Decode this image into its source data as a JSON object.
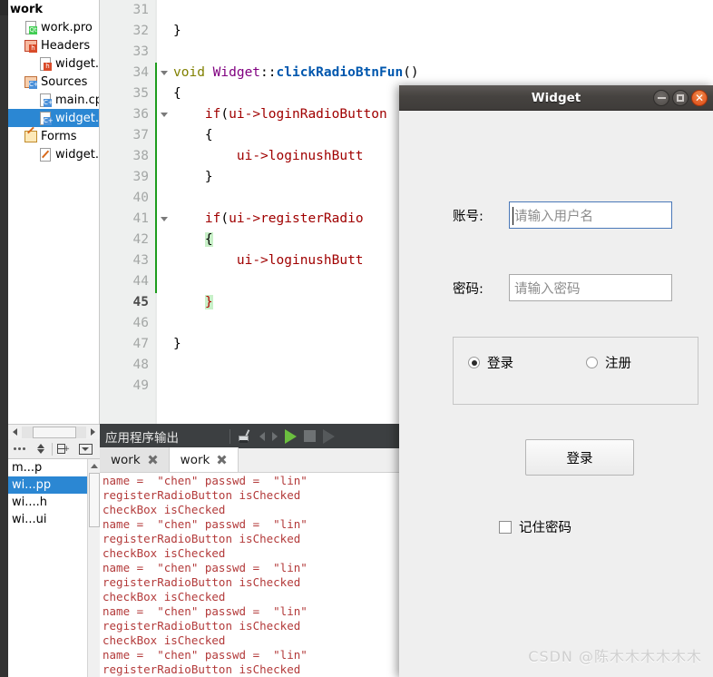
{
  "ide": {
    "project_tree": {
      "items": [
        {
          "label": "work",
          "indent": 0,
          "icon": "project-icon",
          "bold": true,
          "selected": false
        },
        {
          "label": "work.pro",
          "indent": 1,
          "icon": "qt-project-icon",
          "bold": false,
          "selected": false
        },
        {
          "label": "Headers",
          "indent": 1,
          "icon": "headers-folder-icon",
          "bold": false,
          "selected": false
        },
        {
          "label": "widget.h",
          "indent": 2,
          "icon": "header-file-icon",
          "bold": false,
          "selected": false
        },
        {
          "label": "Sources",
          "indent": 1,
          "icon": "sources-folder-icon",
          "bold": false,
          "selected": false
        },
        {
          "label": "main.cpp",
          "indent": 2,
          "icon": "cpp-file-icon",
          "bold": false,
          "selected": false
        },
        {
          "label": "widget.cpp",
          "indent": 2,
          "icon": "cpp-file-icon",
          "bold": false,
          "selected": true
        },
        {
          "label": "Forms",
          "indent": 1,
          "icon": "forms-folder-icon",
          "bold": false,
          "selected": false
        },
        {
          "label": "widget.ui",
          "indent": 2,
          "icon": "ui-file-icon",
          "bold": false,
          "selected": false
        }
      ]
    },
    "open_documents": {
      "items": [
        {
          "label": "m...p",
          "selected": false
        },
        {
          "label": "wi...pp",
          "selected": true
        },
        {
          "label": "wi....h",
          "selected": false
        },
        {
          "label": "wi...ui",
          "selected": false
        }
      ]
    },
    "editor": {
      "first_line": 31,
      "current_line": 45,
      "lines": [
        {
          "n": 31,
          "text": ""
        },
        {
          "n": 32,
          "text": "}"
        },
        {
          "n": 33,
          "text": ""
        },
        {
          "n": 34,
          "text": "void Widget::clickRadioBtnFun()"
        },
        {
          "n": 35,
          "text": "{"
        },
        {
          "n": 36,
          "text": "    if(ui->loginRadioButton"
        },
        {
          "n": 37,
          "text": "    {"
        },
        {
          "n": 38,
          "text": "        ui->loginushButt"
        },
        {
          "n": 39,
          "text": "    }"
        },
        {
          "n": 40,
          "text": ""
        },
        {
          "n": 41,
          "text": "    if(ui->registerRadio"
        },
        {
          "n": 42,
          "text": "    {"
        },
        {
          "n": 43,
          "text": "        ui->loginushButt"
        },
        {
          "n": 44,
          "text": ""
        },
        {
          "n": 45,
          "text": "    }"
        },
        {
          "n": 46,
          "text": ""
        },
        {
          "n": 47,
          "text": "}"
        },
        {
          "n": 48,
          "text": ""
        },
        {
          "n": 49,
          "text": ""
        }
      ]
    },
    "output_pane": {
      "title": "应用程序输出",
      "tools": [
        {
          "name": "clear-output-icon"
        },
        {
          "name": "previous-item-icon"
        },
        {
          "name": "next-item-icon"
        },
        {
          "name": "run-icon"
        },
        {
          "name": "stop-icon"
        },
        {
          "name": "run-with-options-icon"
        }
      ],
      "tabs": [
        {
          "label": "work",
          "active": false
        },
        {
          "label": "work",
          "active": true
        }
      ],
      "console_lines": [
        "name =  \"chen\" passwd =  \"lin\"",
        "registerRadioButton isChecked",
        "checkBox isChecked",
        "name =  \"chen\" passwd =  \"lin\"",
        "registerRadioButton isChecked",
        "checkBox isChecked",
        "name =  \"chen\" passwd =  \"lin\"",
        "registerRadioButton isChecked",
        "checkBox isChecked",
        "name =  \"chen\" passwd =  \"lin\"",
        "registerRadioButton isChecked",
        "checkBox isChecked",
        "name =  \"chen\" passwd =  \"lin\"",
        "registerRadioButton isChecked"
      ]
    }
  },
  "dialog": {
    "title": "Widget",
    "window_buttons": {
      "minimize": "minimize-icon",
      "maximize": "maximize-icon",
      "close": "close-icon"
    },
    "account": {
      "label": "账号:",
      "value": "",
      "placeholder": "请输入用户名",
      "focused": true
    },
    "password": {
      "label": "密码:",
      "value": "",
      "placeholder": "请输入密码",
      "focused": false
    },
    "radios": [
      {
        "label": "登录",
        "checked": true
      },
      {
        "label": "注册",
        "checked": false
      }
    ],
    "submit_label": "登录",
    "remember": {
      "label": "记住密码",
      "checked": false
    }
  },
  "watermark": "CSDN @陈木木木木木木",
  "colors": {
    "accent": "#2b87d3",
    "titlebar": "#464340",
    "close_button": "#dd4814",
    "console_text": "#b33a3a",
    "gutter_marker": "#1d9c1d"
  }
}
